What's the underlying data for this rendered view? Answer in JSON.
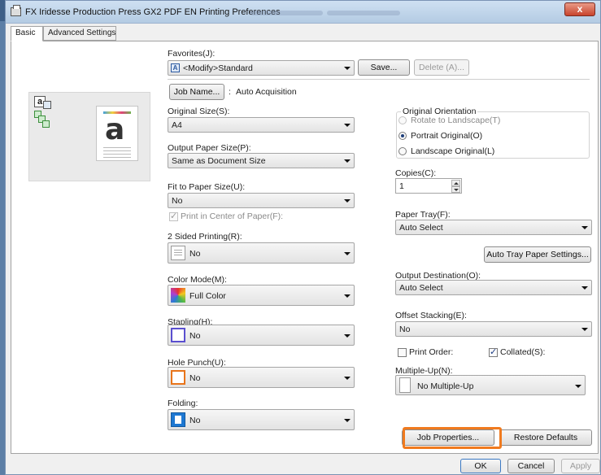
{
  "window": {
    "title": "FX Iridesse Production Press GX2 PDF EN Printing Preferences",
    "close_label": "x"
  },
  "tabs": [
    {
      "label": "Basic",
      "active": true
    },
    {
      "label": "Advanced Settings",
      "active": false
    }
  ],
  "favorites": {
    "label": "Favorites(J):",
    "value": "<Modify>Standard",
    "save_label": "Save...",
    "delete_label": "Delete (A)..."
  },
  "job_name": {
    "button_label": "Job Name...",
    "separator": ":",
    "value": "Auto Acquisition"
  },
  "preview": {
    "letter": "a"
  },
  "original_size": {
    "label": "Original Size(S):",
    "value": "A4"
  },
  "output_paper_size": {
    "label": "Output Paper Size(P):",
    "value": "Same as Document Size"
  },
  "fit_to_paper": {
    "label": "Fit to Paper Size(U):",
    "value": "No",
    "center_label": "Print in Center of Paper(F):",
    "center_checked": true
  },
  "two_sided": {
    "label": "2 Sided Printing(R):",
    "value": "No"
  },
  "color_mode": {
    "label": "Color Mode(M):",
    "value": "Full Color"
  },
  "stapling": {
    "label": "Stapling(H):",
    "value": "No"
  },
  "hole_punch": {
    "label": "Hole Punch(U):",
    "value": "No"
  },
  "folding": {
    "label": "Folding:",
    "value": "No"
  },
  "orientation": {
    "title": "Original Orientation",
    "options": [
      {
        "label": "Rotate to Landscape(T)",
        "selected": false,
        "enabled": false
      },
      {
        "label": "Portrait Original(O)",
        "selected": true,
        "enabled": true
      },
      {
        "label": "Landscape Original(L)",
        "selected": false,
        "enabled": true
      }
    ]
  },
  "copies": {
    "label": "Copies(C):",
    "value": "1"
  },
  "paper_tray": {
    "label": "Paper Tray(F):",
    "value": "Auto Select",
    "settings_label": "Auto Tray Paper Settings..."
  },
  "output_destination": {
    "label": "Output Destination(O):",
    "value": "Auto Select"
  },
  "offset_stacking": {
    "label": "Offset Stacking(E):",
    "value": "No"
  },
  "print_order": {
    "label": "Print Order:",
    "checked": false
  },
  "collated": {
    "label": "Collated(S):",
    "checked": true
  },
  "multiple_up": {
    "label": "Multiple-Up(N):",
    "value": "No Multiple-Up"
  },
  "buttons": {
    "job_properties": "Job Properties...",
    "restore_defaults": "Restore Defaults",
    "ok": "OK",
    "cancel": "Cancel",
    "apply": "Apply"
  },
  "colors": {
    "highlight": "#f07a1e",
    "title_bar": "#b4cbe3",
    "close": "#c8442d"
  }
}
